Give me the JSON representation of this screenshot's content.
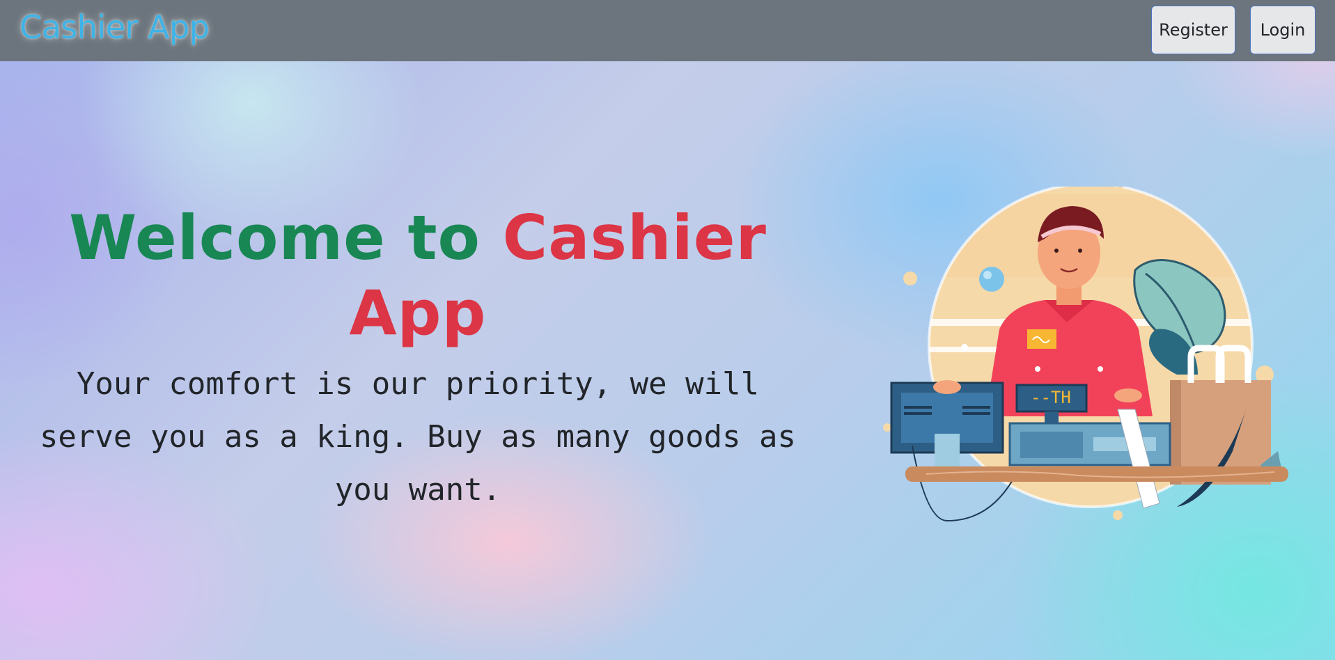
{
  "navbar": {
    "brand": "Cashier App",
    "register_label": "Register",
    "login_label": "Login",
    "background": "#6c757d",
    "brand_color": "#3fb3e6"
  },
  "hero": {
    "heading_part1": "Welcome to",
    "heading_part2": "Cashier App",
    "tagline": "Your comfort is our priority, we will serve you as a king. Buy as many goods as you want.",
    "heading_color_1": "#198754",
    "heading_color_2": "#dc3545",
    "register_display": "--TH",
    "illustration": "cashier-illustration"
  }
}
